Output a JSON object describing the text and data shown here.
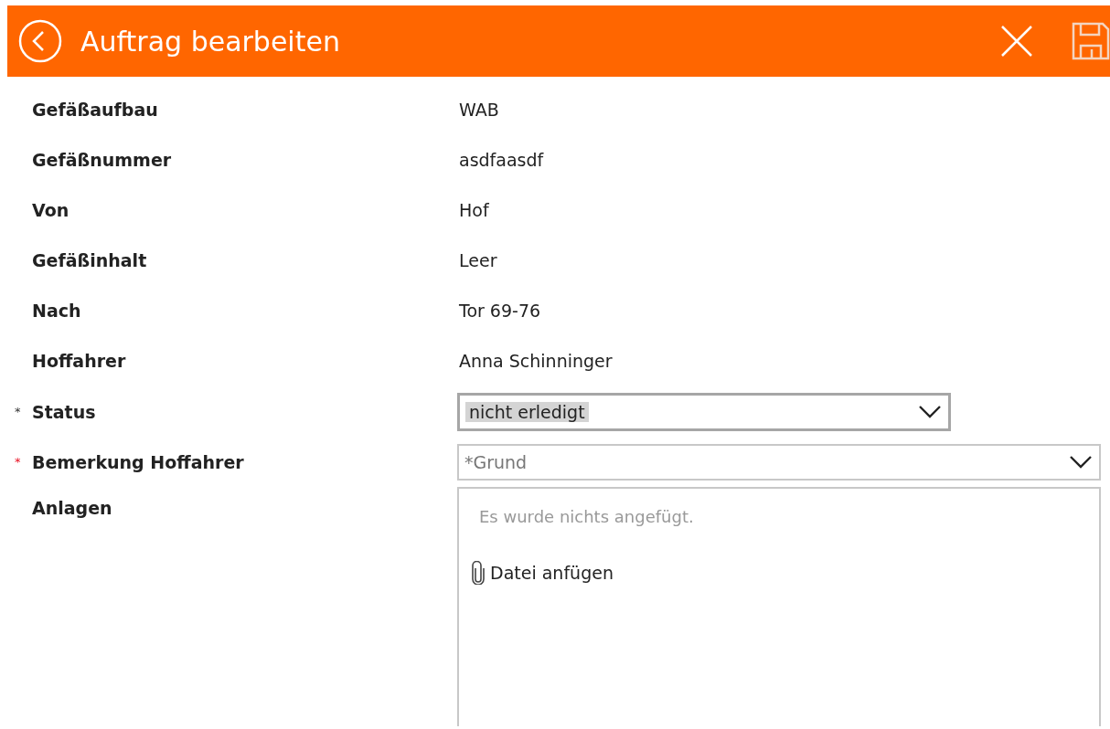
{
  "header": {
    "title": "Auftrag bearbeiten"
  },
  "fields": [
    {
      "kind": "text",
      "label": "Gefäßaufbau",
      "value": "WAB"
    },
    {
      "kind": "text",
      "label": "Gefäßnummer",
      "value": "asdfaasdf"
    },
    {
      "kind": "text",
      "label": "Von",
      "value": "Hof"
    },
    {
      "kind": "text",
      "label": "Gefäßinhalt",
      "value": "Leer"
    },
    {
      "kind": "text",
      "label": "Nach",
      "value": "Tor 69-76"
    },
    {
      "kind": "text",
      "label": "Hoffahrer",
      "value": "Anna Schinninger"
    },
    {
      "kind": "dropdown",
      "label": "Status",
      "required_mark": "*",
      "invalid": false,
      "focused": true,
      "value": "nicht erledigt"
    },
    {
      "kind": "dropdown",
      "label": "Bemerkung Hoffahrer",
      "required_mark": "*",
      "invalid": true,
      "focused": false,
      "placeholder": "*Grund"
    },
    {
      "kind": "attachments",
      "label": "Anlagen",
      "empty_text": "Es wurde nichts angefügt.",
      "action": "Datei anfügen"
    }
  ]
}
